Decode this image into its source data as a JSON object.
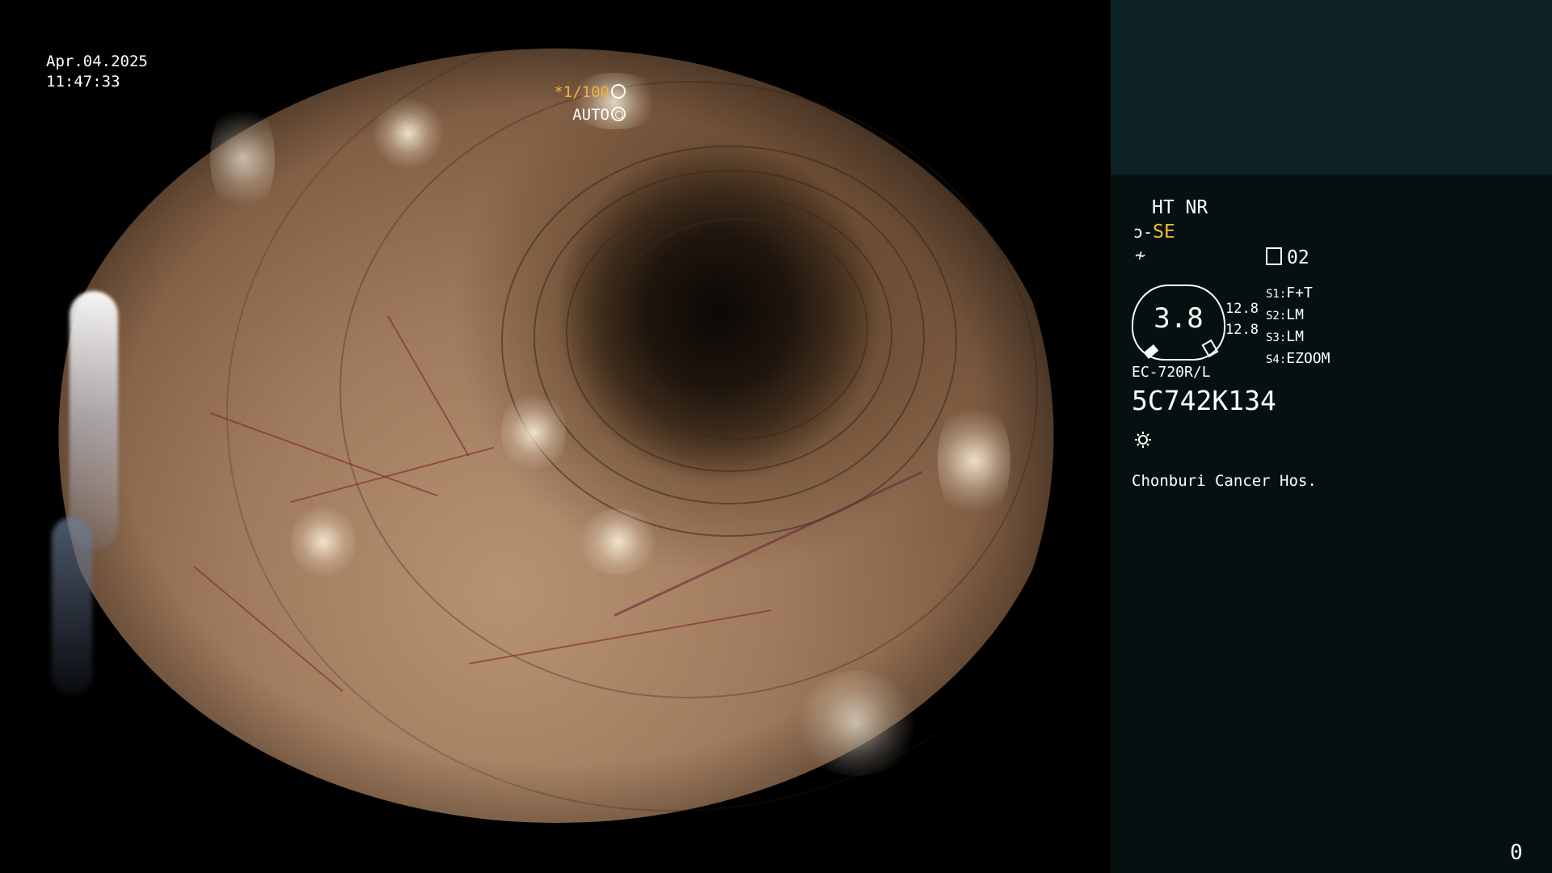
{
  "overlay": {
    "date": "Apr.04.2025",
    "time": "11:47:33",
    "shutter_value": "*1/100",
    "iris_mode": "AUTO"
  },
  "status": {
    "mode_line": "HT NR",
    "se_label": "SE",
    "memory_number": "02",
    "gauge_value": "3.8",
    "gauge_left_1": "12.8",
    "gauge_left_2": "12.8",
    "switches": [
      {
        "key": "S1:",
        "value": "F+T"
      },
      {
        "key": "S2:",
        "value": "LM"
      },
      {
        "key": "S3:",
        "value": "LM"
      },
      {
        "key": "S4:",
        "value": "EZOOM"
      }
    ],
    "scope_model": "EC-720R/L",
    "scope_serial": "5C742K134",
    "hospital": "Chonburi Cancer Hos.",
    "counter": "0"
  },
  "icons": [
    "shutter-icon",
    "iris-icon",
    "se-icon",
    "enhance-icon",
    "memory-icon",
    "light-icon"
  ],
  "colors": {
    "accent_yellow": "#f5b63a",
    "panel_top": "#0d2222",
    "panel_bottom": "#051110"
  }
}
